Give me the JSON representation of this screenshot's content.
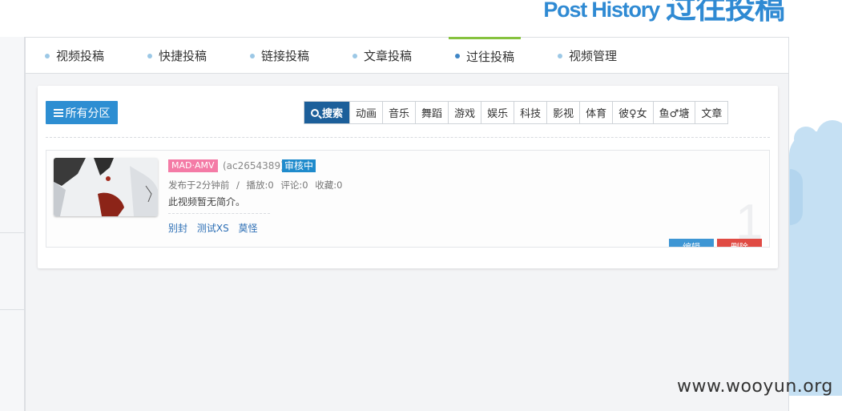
{
  "banner": {
    "title_en": "Post History",
    "title_cn": "过往投稿"
  },
  "tabs": [
    {
      "label": "视频投稿",
      "active": false
    },
    {
      "label": "快捷投稿",
      "active": false
    },
    {
      "label": "链接投稿",
      "active": false
    },
    {
      "label": "文章投稿",
      "active": false
    },
    {
      "label": "过往投稿",
      "active": true
    },
    {
      "label": "视频管理",
      "active": false
    }
  ],
  "toolbar": {
    "category_button": "所有分区",
    "search_button": "搜索",
    "filters": [
      "动画",
      "音乐",
      "舞蹈",
      "游戏",
      "娱乐",
      "科技",
      "影视",
      "体育",
      "彼♀女",
      "鱼♂塘",
      "文章"
    ]
  },
  "post": {
    "tag": "MAD·AMV",
    "ac_id": "(ac2654389)",
    "status": "审核中",
    "published": "发布于2分钟前",
    "meta_sep": "/",
    "plays": "播放:0",
    "comments": "评论:0",
    "favorites": "收藏:0",
    "description": "此视频暂无简介。",
    "tags": [
      "别封",
      "测试XS",
      "莫怪"
    ],
    "index_number": "1",
    "edit_button": "编辑",
    "delete_button": "删除"
  },
  "watermark": "www.wooyun.org",
  "colors": {
    "brand_blue": "#2f8ad3",
    "search_active": "#1c5f9a",
    "tab_active_bar": "#86c23e",
    "tag_pink": "#f47ba6",
    "status_blue": "#1f8bcc",
    "delete_red": "#e04b44"
  }
}
